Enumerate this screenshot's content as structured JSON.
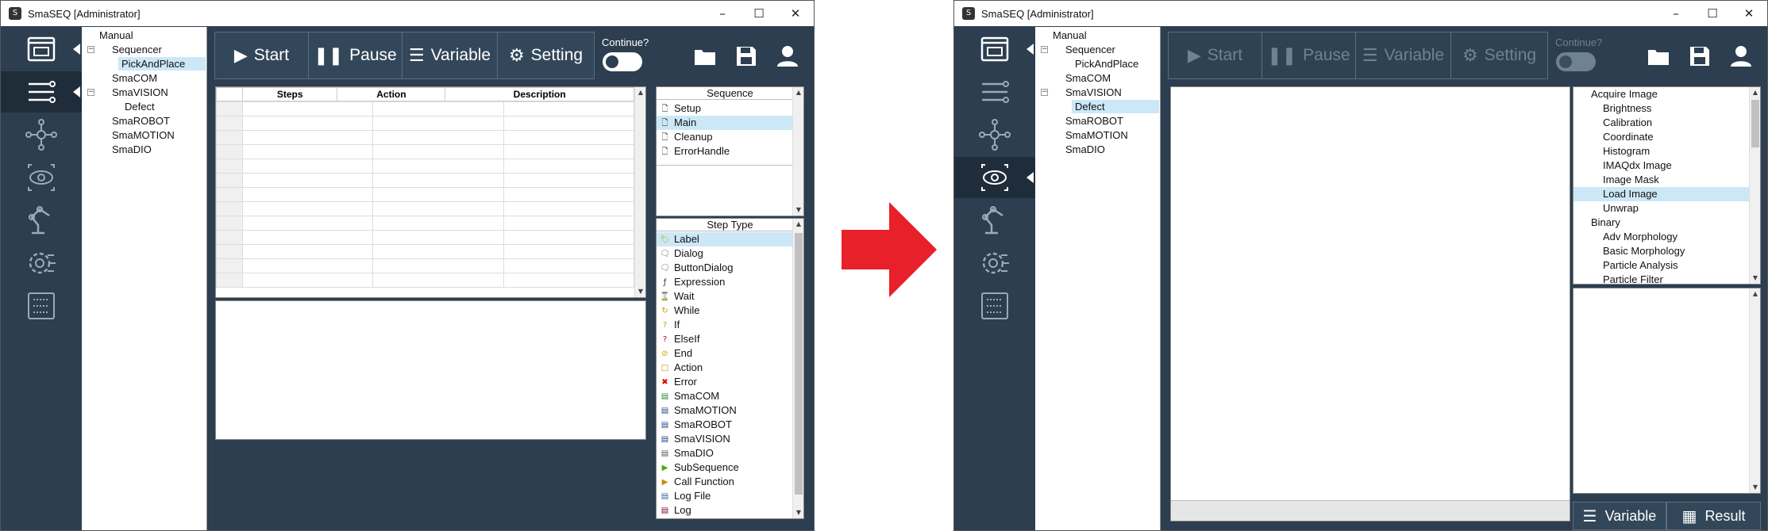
{
  "left_window": {
    "title": "SmaSEQ  [Administrator]",
    "tree": [
      "Manual",
      "Sequencer",
      "PickAndPlace",
      "SmaCOM",
      "SmaVISION",
      "Defect",
      "SmaROBOT",
      "SmaMOTION",
      "SmaDIO"
    ],
    "toolbar": {
      "start": "Start",
      "pause": "Pause",
      "variable": "Variable",
      "setting": "Setting"
    },
    "continue_label": "Continue?",
    "grid_headers": [
      "Steps",
      "Action",
      "Description"
    ],
    "sequence_header": "Sequence",
    "sequence_items": [
      "Setup",
      "Main",
      "Cleanup",
      "ErrorHandle"
    ],
    "steptype_header": "Step Type",
    "steptype_items": [
      "Label",
      "Dialog",
      "ButtonDialog",
      "Expression",
      "Wait",
      "While",
      "If",
      "ElseIf",
      "End",
      "Action",
      "Error",
      "SmaCOM",
      "SmaMOTION",
      "SmaROBOT",
      "SmaVISION",
      "SmaDIO",
      "SubSequence",
      "Call Function",
      "Log File",
      "Log"
    ]
  },
  "right_window": {
    "title": "SmaSEQ  [Administrator]",
    "tree": [
      "Manual",
      "Sequencer",
      "PickAndPlace",
      "SmaCOM",
      "SmaVISION",
      "Defect",
      "SmaROBOT",
      "SmaMOTION",
      "SmaDIO"
    ],
    "toolbar": {
      "start": "Start",
      "pause": "Pause",
      "variable": "Variable",
      "setting": "Setting"
    },
    "continue_label": "Continue?",
    "vision_tree": [
      "Acquire Image",
      "Brightness",
      "Calibration",
      "Coordinate",
      "Histogram",
      "IMAQdx Image",
      "Image Mask",
      "Load Image",
      "Unwrap",
      "Binary",
      "Adv Morphology",
      "Basic Morphology",
      "Particle Analysis",
      "Particle Filter"
    ],
    "bottom_tabs": {
      "variable": "Variable",
      "result": "Result"
    }
  },
  "colors": {
    "sidebar": "#2c3e50",
    "selection": "#cce8f7",
    "arrow": "#e8202a"
  }
}
